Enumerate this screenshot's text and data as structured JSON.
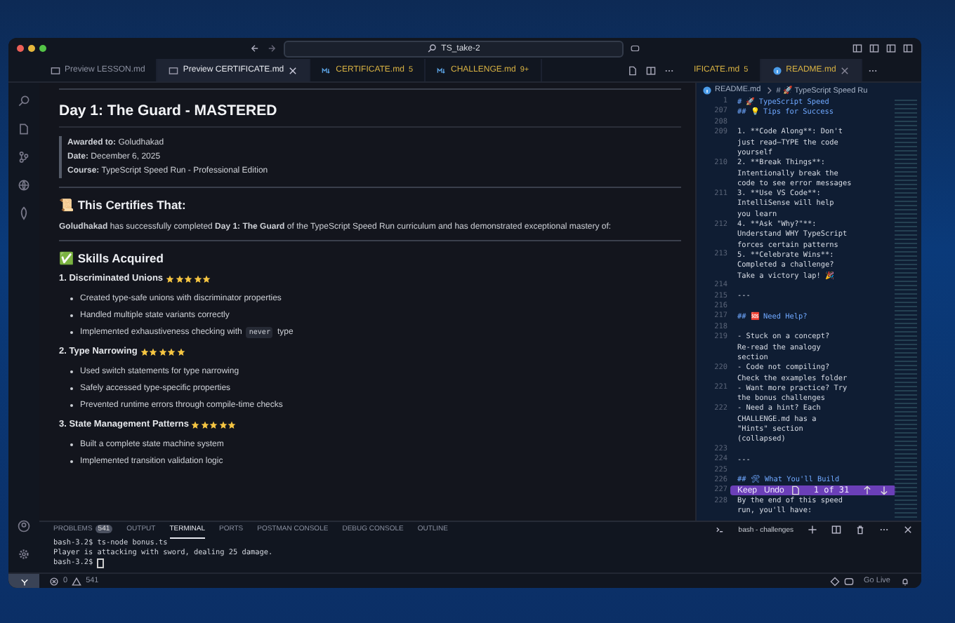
{
  "title_bar": {
    "search": "TS_take-2"
  },
  "tabs": [
    {
      "label": "Preview LESSON.md",
      "kind": "preview",
      "selected": false,
      "warning": false
    },
    {
      "label": "Preview CERTIFICATE.md",
      "kind": "preview",
      "selected": true,
      "warning": false
    },
    {
      "label": "CERTIFICATE.md",
      "kind": "markdown",
      "selected": false,
      "warning": true,
      "badge": "5"
    },
    {
      "label": "CHALLENGE.md",
      "kind": "markdown",
      "selected": false,
      "warning": true,
      "badge": "9+"
    }
  ],
  "right_tabs": [
    {
      "label": "IFICATE.md",
      "kind": "plain",
      "selected": false,
      "warning": true,
      "badge": "5"
    },
    {
      "label": "README.md",
      "kind": "info",
      "selected": true,
      "warning": true
    }
  ],
  "preview": {
    "title": "Day 1: The Guard - MASTERED",
    "meta": [
      "**Awarded to:** Goludhakad",
      "**Date:** December 6, 2025",
      "**Course:** TypeScript Speed Run - Professional Edition"
    ],
    "certifies_heading": "📜 This Certifies That:",
    "certifies_text": "**Goludhakad** has successfully completed **Day 1: The Guard** of the TypeScript Speed Run curriculum and has demonstrated exceptional mastery of:",
    "skills_heading": "✅ Skills Acquired",
    "skills": [
      {
        "title": "1. Discriminated Unions",
        "stars": 5,
        "items": [
          {
            "text": "Created type-safe unions with discriminator properties"
          },
          {
            "text": "Handled multiple state variants correctly"
          },
          {
            "text": "Implemented exhaustiveness checking with",
            "code": "never",
            "after": "type"
          }
        ]
      },
      {
        "title": "2. Type Narrowing",
        "stars": 5,
        "items": [
          {
            "text": "Used switch statements for type narrowing"
          },
          {
            "text": "Safely accessed type-specific properties"
          },
          {
            "text": "Prevented runtime errors through compile-time checks"
          }
        ]
      },
      {
        "title": "3. State Management Patterns",
        "stars": 5,
        "items": [
          {
            "text": "Built a complete state machine system"
          },
          {
            "text": "Implemented transition validation logic"
          }
        ]
      }
    ]
  },
  "readme": {
    "breadcrumb": [
      "README.md",
      "# 🚀 TypeScript Speed Ru"
    ],
    "lines": [
      {
        "number": "1",
        "wraps": [
          "# 🚀 TypeScript Speed"
        ],
        "kind": "heading"
      },
      {
        "number": "207",
        "wraps": [
          "## 💡 Tips for Success"
        ],
        "kind": "heading"
      },
      {
        "number": "208"
      },
      {
        "number": "209",
        "wraps": [
          "1. **Code Along**: Don't",
          "just read—TYPE the code",
          "yourself"
        ],
        "kind": "text"
      },
      {
        "number": "210",
        "wraps": [
          "2. **Break Things**:",
          "Intentionally break the",
          "code to see error messages"
        ],
        "kind": "text"
      },
      {
        "number": "211",
        "wraps": [
          "3. **Use VS Code**:",
          "IntelliSense will help",
          "you learn"
        ],
        "kind": "text"
      },
      {
        "number": "212",
        "wraps": [
          "4. **Ask \"Why?\"**:",
          "Understand WHY TypeScript",
          "forces certain patterns"
        ],
        "kind": "text"
      },
      {
        "number": "213",
        "wraps": [
          "5. **Celebrate Wins**:",
          "Completed a challenge?",
          "Take a victory lap! 🎉"
        ],
        "kind": "text"
      },
      {
        "number": "214"
      },
      {
        "number": "215",
        "wraps": [
          "---"
        ],
        "kind": "text"
      },
      {
        "number": "216"
      },
      {
        "number": "217",
        "wraps": [
          "## 🆘 Need Help?"
        ],
        "kind": "heading"
      },
      {
        "number": "218"
      },
      {
        "number": "219",
        "wraps": [
          "- Stuck on a concept?",
          "Re-read the analogy",
          "section"
        ],
        "kind": "text"
      },
      {
        "number": "220",
        "wraps": [
          "- Code not compiling?",
          "Check the examples folder"
        ],
        "kind": "text"
      },
      {
        "number": "221",
        "wraps": [
          "- Want more practice? Try",
          "the bonus challenges"
        ],
        "kind": "text"
      },
      {
        "number": "222",
        "wraps": [
          "- Need a hint? Each",
          "CHALLENGE.md has a",
          "\"Hints\" section",
          "(collapsed)"
        ],
        "kind": "text"
      },
      {
        "number": "223"
      },
      {
        "number": "224",
        "wraps": [
          "---"
        ],
        "kind": "text"
      },
      {
        "number": "225"
      },
      {
        "number": "226",
        "wraps": [
          "## 🛠 What You'll Build"
        ],
        "kind": "heading"
      },
      {
        "number": "227"
      },
      {
        "number": "228",
        "wraps": [
          "By the end of this speed",
          "run, you'll have:"
        ],
        "kind": "text"
      }
    ],
    "review_bar": {
      "keep": "Keep",
      "undo": "Undo",
      "counter": "1 of 31"
    }
  },
  "panel": {
    "tabs": [
      {
        "label": "PROBLEMS",
        "badge": "541",
        "selected": false
      },
      {
        "label": "OUTPUT",
        "selected": false
      },
      {
        "label": "TERMINAL",
        "selected": true
      },
      {
        "label": "PORTS",
        "selected": false
      },
      {
        "label": "POSTMAN CONSOLE",
        "selected": false
      },
      {
        "label": "DEBUG CONSOLE",
        "selected": false
      },
      {
        "label": "OUTLINE",
        "selected": false
      }
    ],
    "terminal_name": "bash - challenges",
    "terminal_lines": [
      "bash-3.2$ ts-node bonus.ts",
      "Player is attacking with sword, dealing 25 damage.",
      "bash-3.2$ "
    ]
  },
  "status_bar": {
    "errors": "0",
    "warnings": "541",
    "go_live": "Go Live"
  }
}
